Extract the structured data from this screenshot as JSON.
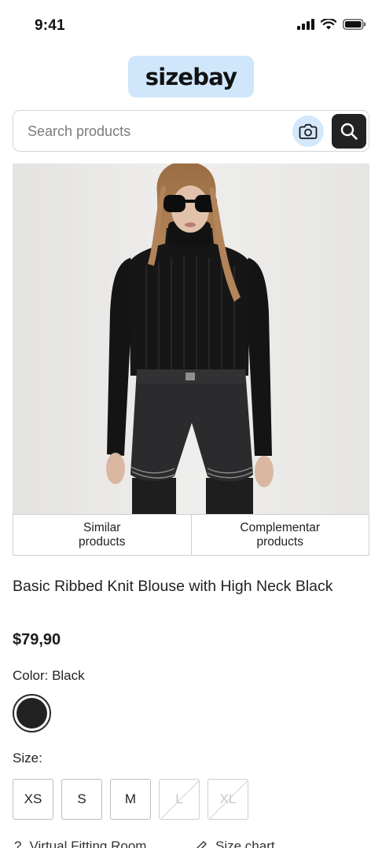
{
  "status_bar": {
    "time": "9:41"
  },
  "brand": {
    "logo_text": "sizebay",
    "accent_color": "#cfe6fb"
  },
  "search": {
    "placeholder": "Search products",
    "value": ""
  },
  "product": {
    "image_alt": "Model wearing black ribbed turtleneck blouse with black denim shorts",
    "tabs": [
      "Similar\nproducts",
      "Complementar\nproducts"
    ],
    "title": "Basic Ribbed Knit Blouse with High Neck Black",
    "price": "$79,90",
    "color_label": "Color: Black",
    "color_swatch": "#222222",
    "size_label": "Size:",
    "sizes": [
      {
        "label": "XS",
        "available": true
      },
      {
        "label": "S",
        "available": true
      },
      {
        "label": "M",
        "available": true
      },
      {
        "label": "L",
        "available": false
      },
      {
        "label": "XL",
        "available": false
      }
    ]
  },
  "links": {
    "virtual_fitting": "Virtual Fitting Room",
    "size_chart": "Size chart"
  }
}
